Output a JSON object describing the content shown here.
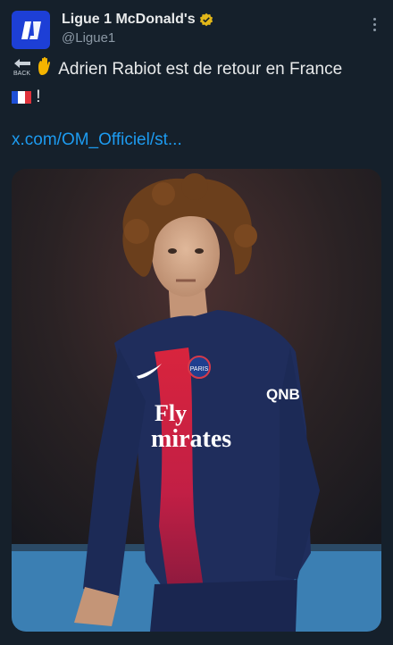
{
  "account": {
    "display_name": "Ligue 1 McDonald's",
    "handle": "@Ligue1",
    "avatar_text": "L1",
    "verified_icon": "verified-gold-badge-icon",
    "brand_color": "#1d3fd6"
  },
  "tweet": {
    "text": "Adrien Rabiot est de retour en France",
    "exclamation": "!",
    "link_text": "x.com/OM_Officiel/st...",
    "back_icon_label": "BACK"
  },
  "media": {
    "description_alt": "Player in PSG jersey",
    "sponsor_line1": "Fly",
    "sponsor_line2": "mirates",
    "sleeve_sponsor": "QNB",
    "crest_text": "PARIS"
  },
  "colors": {
    "background": "#15202b",
    "link": "#1d9bf0",
    "muted": "#8b98a5",
    "jersey": "#1f2d5c"
  }
}
